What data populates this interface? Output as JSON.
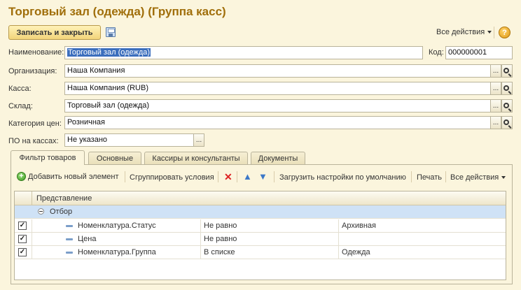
{
  "window": {
    "title": "Торговый зал (одежда) (Группа касс)"
  },
  "toolbar": {
    "save_close_label": "Записать и закрыть",
    "all_actions_label": "Все действия",
    "help_label": "?"
  },
  "form": {
    "name_label": "Наименование:",
    "name_value": "Торговый зал (одежда)",
    "code_label": "Код:",
    "code_value": "000000001",
    "org_label": "Организация:",
    "org_value": "Наша Компания",
    "cash_label": "Касса:",
    "cash_value": "Наша Компания (RUB)",
    "warehouse_label": "Склад:",
    "warehouse_value": "Торговый зал (одежда)",
    "price_cat_label": "Категория цен:",
    "price_cat_value": "Розничная",
    "software_label": "ПО на кассах:",
    "software_value": "Не указано",
    "ellipsis": "...",
    "search_icon": "search-icon"
  },
  "tabs": [
    {
      "label": "Фильтр товаров",
      "active": true
    },
    {
      "label": "Основные",
      "active": false
    },
    {
      "label": "Кассиры и консультанты",
      "active": false
    },
    {
      "label": "Документы",
      "active": false
    }
  ],
  "filter_toolbar": {
    "add_label": "Добавить новый элемент",
    "group_label": "Сгруппировать условия",
    "delete_icon": "delete-icon",
    "up_icon": "arrow-up-icon",
    "down_icon": "arrow-down-icon",
    "load_defaults_label": "Загрузить настройки по умолчанию",
    "print_label": "Печать",
    "all_actions_label": "Все действия"
  },
  "grid": {
    "header": "Представление",
    "group_label": "Отбор",
    "rows": [
      {
        "checked": true,
        "field": "Номенклатура.Статус",
        "condition": "Не равно",
        "value": "Архивная"
      },
      {
        "checked": true,
        "field": "Цена",
        "condition": "Не равно",
        "value": ""
      },
      {
        "checked": true,
        "field": "Номенклатура.Группа",
        "condition": "В списке",
        "value": "Одежда"
      }
    ]
  },
  "colors": {
    "title": "#a06e0a",
    "background": "#fbf5dd",
    "selection": "#cfe2f6"
  }
}
